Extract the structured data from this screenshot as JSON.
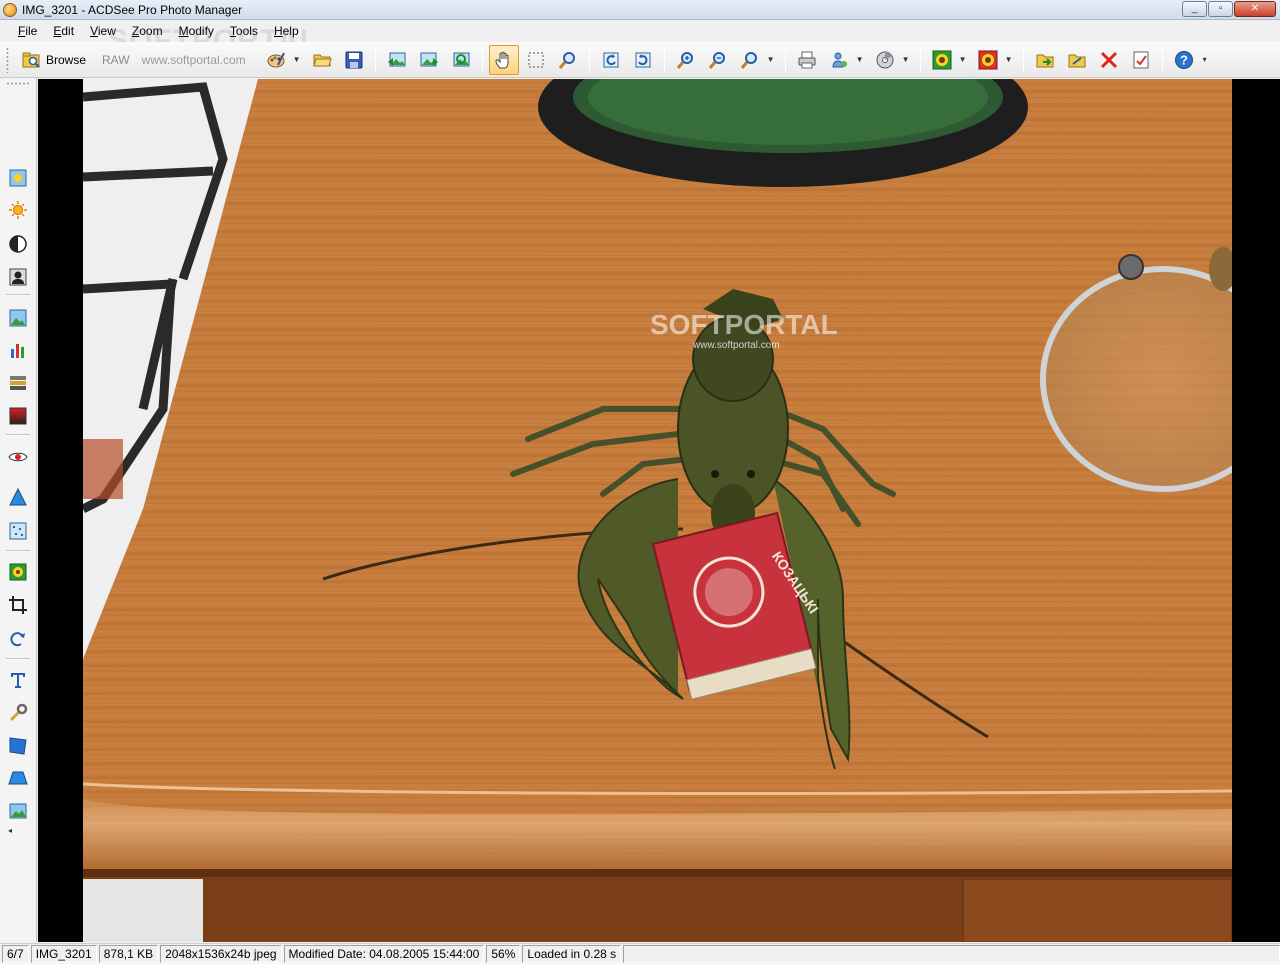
{
  "window": {
    "title": "IMG_3201 - ACDSee Pro Photo Manager",
    "controls": [
      "_",
      "▫",
      "✕"
    ]
  },
  "menu": [
    "File",
    "Edit",
    "View",
    "Zoom",
    "Modify",
    "Tools",
    "Help"
  ],
  "toolbar": {
    "browse_label": "Browse",
    "raw_label": "RAW",
    "watermark": "SOFTPORTAL",
    "watermark_url": "www.softportal.com"
  },
  "photo": {
    "watermark": "SOFTPORTAL",
    "watermark_url": "www.softportal.com",
    "matchbox_text": "КОЗАЦЬКI"
  },
  "status": {
    "index": "6/7",
    "filename": "IMG_3201",
    "filesize": "878,1 KB",
    "dimensions": "2048x1536x24b jpeg",
    "modified": "Modified Date: 04.08.2005 15:44:00",
    "zoom": "56%",
    "loaded": "Loaded in 0.28 s"
  },
  "colors": {
    "accent": "#ffd27a",
    "wood": "#c67c3a",
    "crayfish": "#4b5426",
    "matchbox": "#c8323c"
  }
}
